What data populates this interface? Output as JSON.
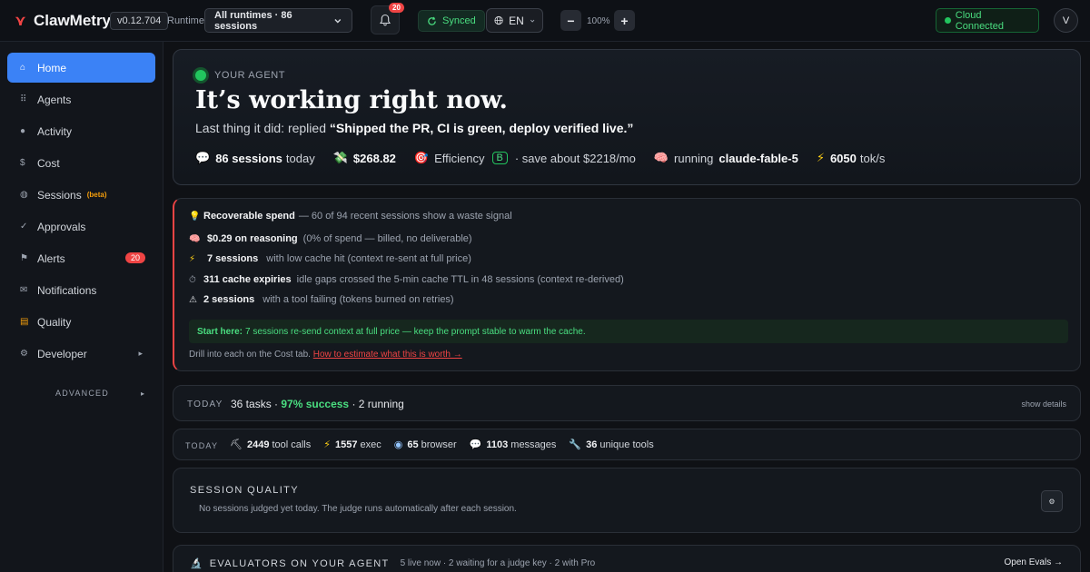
{
  "topbar": {
    "app_name": "ClawMetry",
    "version": "v0.12.704",
    "runtime_label": "Runtime",
    "runtime_value": "All runtimes · 86 sessions",
    "notifications_count": "20",
    "sync_status": "Synced",
    "language": "EN",
    "zoom": "100%",
    "cloud_status": "Cloud Connected",
    "avatar_initial": "V"
  },
  "sidebar": {
    "items": [
      {
        "label": "Home"
      },
      {
        "label": "Agents"
      },
      {
        "label": "Activity"
      },
      {
        "label": "Cost"
      },
      {
        "label": "Sessions",
        "badge": "(beta)"
      },
      {
        "label": "Approvals"
      },
      {
        "label": "Alerts",
        "count": "20"
      },
      {
        "label": "Notifications"
      },
      {
        "label": "Quality"
      },
      {
        "label": "Developer"
      }
    ],
    "advanced": "ADVANCED"
  },
  "hero": {
    "status": "YOUR AGENT",
    "headline": "It’s working right now.",
    "last_prefix": "Last thing it did: replied ",
    "last_quote": "“Shipped the PR, CI is green, deploy verified live.”",
    "sessions_value": "86 sessions",
    "sessions_suffix": "today",
    "spend": "$268.82",
    "efficiency_label": "Efficiency",
    "efficiency_grade": "B",
    "efficiency_suffix": "· save about $2218/mo",
    "model_prefix": "running",
    "model": "claude-fable-5",
    "speed_value": "6050",
    "speed_unit": "tok/s"
  },
  "waste": {
    "title": "Recoverable spend",
    "title_suffix": "— 60 of 94 recent sessions show a waste signal",
    "rows": [
      {
        "value": "$0.29 on reasoning",
        "text": "(0% of spend — billed, no deliverable)"
      },
      {
        "value": "7 sessions",
        "text": "with low cache hit (context re-sent at full price)"
      },
      {
        "value": "311 cache expiries",
        "text": "idle gaps crossed the 5-min cache TTL in 48 sessions (context re-derived)"
      },
      {
        "value": "2 sessions",
        "text": "with a tool failing (tokens burned on retries)"
      }
    ],
    "start_label": "Start here:",
    "start_text": "7 sessions re-send context at full price — keep the prompt stable to warm the cache.",
    "drill_text": "Drill into each on the Cost tab.",
    "drill_link": "How to estimate what this is worth →"
  },
  "today_summary": {
    "tag": "TODAY",
    "tasks": "36 tasks ·",
    "success": "97% success",
    "running": "· 2 running",
    "show_details": "show details"
  },
  "today_tools": {
    "tag": "TODAY",
    "items": [
      {
        "value": "2449",
        "label": "tool calls"
      },
      {
        "value": "1557",
        "label": "exec"
      },
      {
        "value": "65",
        "label": "browser"
      },
      {
        "value": "1103",
        "label": "messages"
      },
      {
        "value": "36",
        "label": "unique tools"
      }
    ]
  },
  "quality": {
    "title": "SESSION QUALITY",
    "desc": "No sessions judged yet today. The judge runs automatically after each session."
  },
  "evaluators": {
    "title": "EVALUATORS ON YOUR AGENT",
    "subtitle": "5 live now · 2 waiting for a judge key · 2 with Pro",
    "open": "Open Evals →"
  },
  "colors": {
    "accent": "#3b82f6",
    "success": "#22c55e",
    "danger": "#ef4444",
    "warning": "#f59e0b",
    "background": "#0f1115"
  }
}
